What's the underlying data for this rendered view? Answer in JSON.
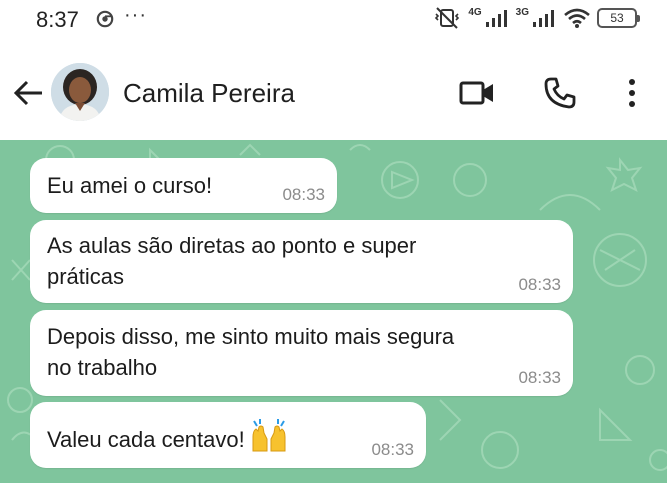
{
  "status_bar": {
    "time": "8:37",
    "more": "···",
    "network_1": "4G",
    "network_2": "3G",
    "battery": "53"
  },
  "header": {
    "contact_name": "Camila Pereira",
    "icons": [
      "back-arrow-icon",
      "video-call-icon",
      "phone-icon",
      "more-vertical-icon"
    ]
  },
  "messages": [
    {
      "text": "Eu amei o curso!",
      "time": "08:33"
    },
    {
      "text_lines": [
        "As aulas são diretas ao ponto e super",
        "práticas"
      ],
      "time": "08:33"
    },
    {
      "text_lines": [
        "Depois disso, me sinto muito mais segura",
        "no trabalho"
      ],
      "time": "08:33"
    },
    {
      "text": "Valeu cada centavo!",
      "emoji": "raising-hands-icon",
      "time": "08:33"
    }
  ],
  "colors": {
    "chat_background": "#7fc59d",
    "bubble": "#ffffff",
    "timestamp": "#8b8b8b"
  }
}
